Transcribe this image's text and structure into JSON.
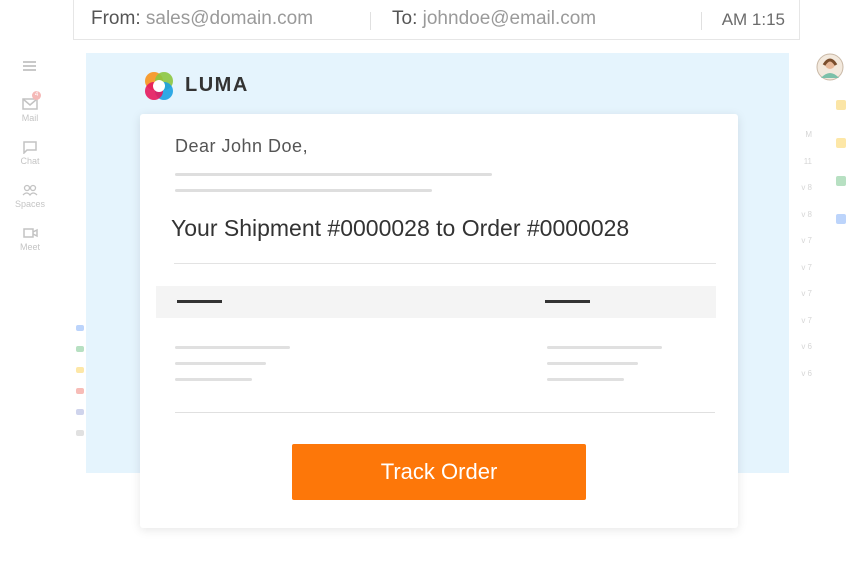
{
  "header": {
    "from_label": "From:",
    "from_value": "sales@domain.com",
    "to_label": "To:",
    "to_value": "johndoe@email.com",
    "time": "AM 1:15"
  },
  "brand": {
    "name": "LUMA"
  },
  "email": {
    "greeting": "Dear John Doe,",
    "subject": "Your Shipment #0000028 to Order #0000028",
    "button_label": "Track Order"
  },
  "background_app": {
    "rail": [
      {
        "label": "Mail",
        "icon": "mail-icon",
        "badge": "4"
      },
      {
        "label": "Chat",
        "icon": "chat-icon"
      },
      {
        "label": "Spaces",
        "icon": "spaces-icon"
      },
      {
        "label": "Meet",
        "icon": "meet-icon"
      }
    ],
    "dates": [
      "M",
      "11",
      "v 8",
      "v 8",
      "v 7",
      "v 7",
      "v 7",
      "v 7",
      "v 6",
      "v 6"
    ]
  },
  "colors": {
    "accent": "#fd7709",
    "panel": "#e5f4fd",
    "logo": [
      "#f7941d",
      "#8cc63f",
      "#1ba1e2",
      "#e5195d"
    ]
  }
}
